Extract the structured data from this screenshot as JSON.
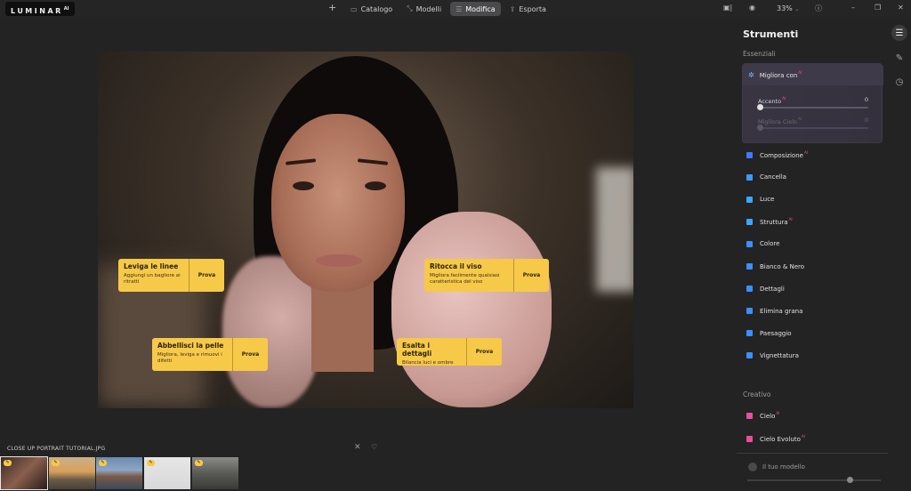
{
  "app": {
    "logo": "LUMINAR",
    "logo_sup": "AI"
  },
  "nav": {
    "plus_icon": "plus-icon",
    "items": [
      {
        "label": "Catalogo",
        "icon": "folder-icon"
      },
      {
        "label": "Modelli",
        "icon": "templates-icon"
      },
      {
        "label": "Modifica",
        "icon": "edit-icon",
        "active": true
      },
      {
        "label": "Esporta",
        "icon": "export-icon"
      }
    ]
  },
  "top_right": {
    "zoom": "33%"
  },
  "canvas": {
    "cards": [
      {
        "title": "Leviga le linee",
        "desc": "Aggiungi un bagliore ai ritratti",
        "btn": "Prova"
      },
      {
        "title": "Ritocca il viso",
        "desc": "Migliora facilmente qualsiasi caratteristica del viso",
        "btn": "Prova"
      },
      {
        "title": "Abbellisci la pelle",
        "desc": "Migliora, leviga e rimuovi i difetti",
        "btn": "Prova"
      },
      {
        "title": "Esalta i dettagli",
        "desc": "Bilancia luci e ombre",
        "btn": "Prova"
      }
    ]
  },
  "filmstrip": {
    "filename": "CLOSE UP PORTRAIT TUTORIAL.JPG"
  },
  "panel": {
    "title": "Strumenti",
    "essentials_label": "Essenziali",
    "boost": {
      "title": "Migliora con",
      "ai": "AI",
      "accent": {
        "label": "Accento",
        "value": "0",
        "level": 0
      },
      "sky": {
        "label": "Migliora Cielo",
        "value": "0",
        "level": 0
      }
    },
    "tools": [
      {
        "label": "Composizione",
        "ai": true,
        "color": "#3b7bff"
      },
      {
        "label": "Cancella",
        "ai": false,
        "color": "#3b9bff"
      },
      {
        "label": "Luce",
        "ai": false,
        "color": "#3ba6ff"
      },
      {
        "label": "Struttura",
        "ai": true,
        "color": "#3ba6ff"
      },
      {
        "label": "Colore",
        "ai": false,
        "color": "#3b8fff"
      },
      {
        "label": "Bianco & Nero",
        "ai": false,
        "color": "#3b8fff"
      },
      {
        "label": "Dettagli",
        "ai": false,
        "color": "#3b8fff"
      },
      {
        "label": "Elimina grana",
        "ai": false,
        "color": "#3b8fff"
      },
      {
        "label": "Paesaggio",
        "ai": false,
        "color": "#3b8fff"
      },
      {
        "label": "Vignettatura",
        "ai": false,
        "color": "#3b8fff"
      }
    ],
    "creative_label": "Creativo",
    "creative_tools": [
      {
        "label": "Cielo",
        "ai": true,
        "color": "#e84fa0"
      },
      {
        "label": "Cielo Evoluto",
        "ai": true,
        "color": "#e84fa0"
      }
    ],
    "model": {
      "label": "Il tuo modello"
    }
  }
}
